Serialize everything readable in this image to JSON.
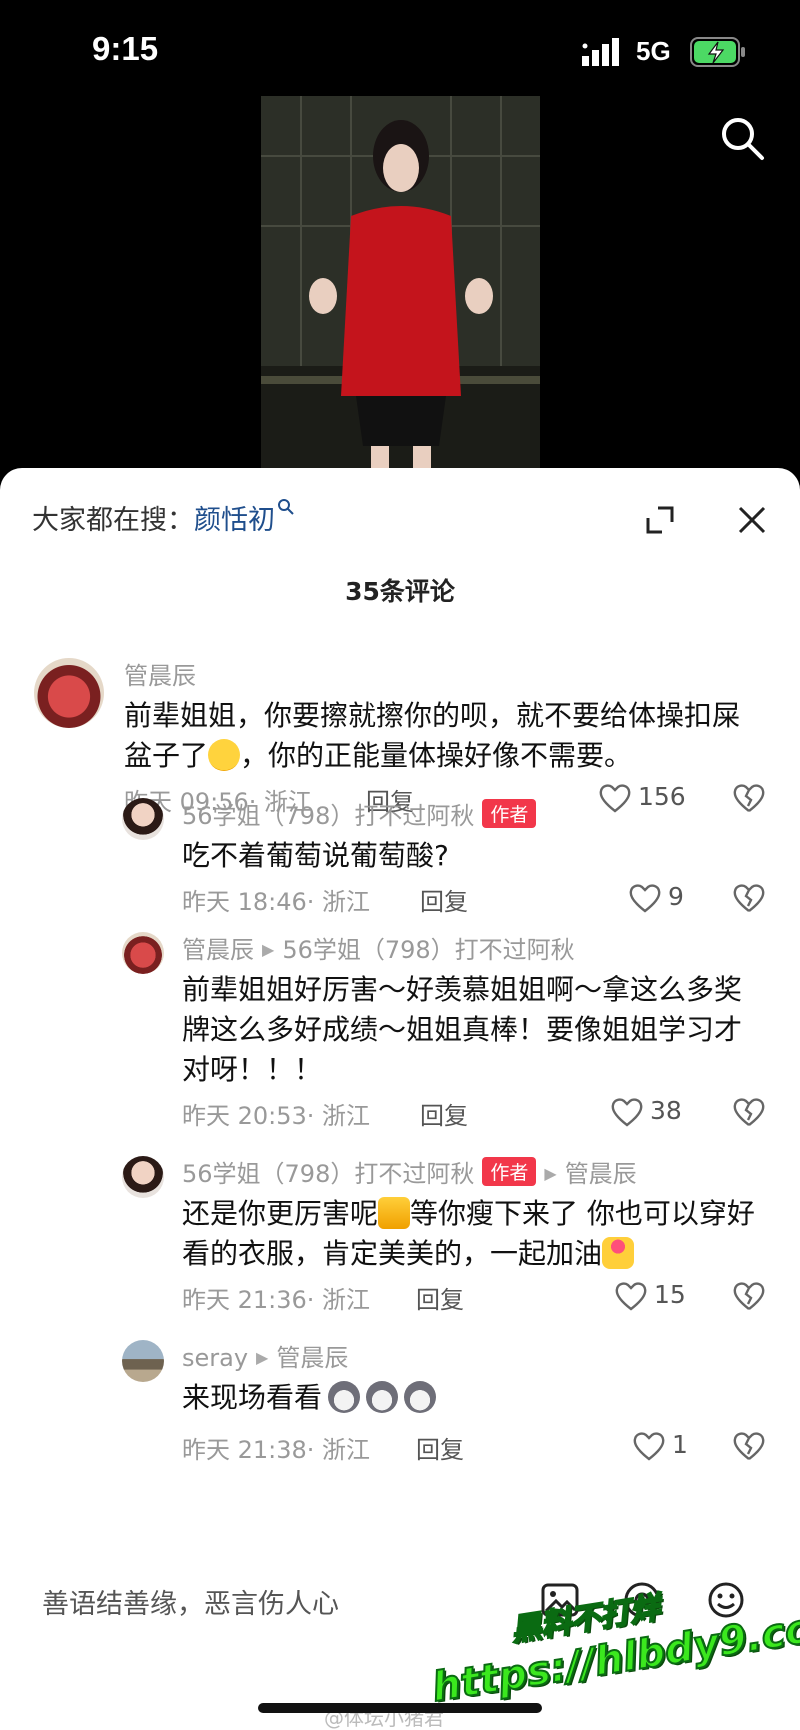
{
  "status": {
    "time": "9:15",
    "network": "5G"
  },
  "trending": {
    "prefix": "大家都在搜：",
    "term": "颜恬初"
  },
  "comments_count": "35条评论",
  "comments": [
    {
      "user": "管晨辰",
      "reply_to": "",
      "is_author": false,
      "text_parts": [
        "前辈姐姐，你要擦就擦你的呗，就不要给体操扣屎盆子了",
        "，你的正能量体操好像不需要。"
      ],
      "time": "昨天 09:56· 浙江",
      "reply": "回复",
      "likes": "156"
    },
    {
      "user": "56学姐（798）打不过阿秋",
      "reply_to": "",
      "is_author": true,
      "text_parts": [
        "吃不着葡萄说葡萄酸?"
      ],
      "time": "昨天 18:46· 浙江",
      "reply": "回复",
      "likes": "9"
    },
    {
      "user": "管晨辰",
      "reply_to": "56学姐（798）打不过阿秋",
      "is_author": false,
      "text_parts": [
        "前辈姐姐好厉害～好羡慕姐姐啊～拿这么多奖牌这么多好成绩～姐姐真棒！要像姐姐学习才对呀！！！"
      ],
      "time": "昨天 20:53· 浙江",
      "reply": "回复",
      "likes": "38"
    },
    {
      "user": "56学姐（798）打不过阿秋",
      "reply_to": "管晨辰",
      "is_author": true,
      "text_parts": [
        "还是你更厉害呢",
        "等你瘦下来了 你也可以穿好看的衣服，肯定美美的，一起加油"
      ],
      "time": "昨天 21:36· 浙江",
      "reply": "回复",
      "likes": "15"
    },
    {
      "user": "seray",
      "reply_to": "管晨辰",
      "is_author": false,
      "text_parts": [
        "来现场看看"
      ],
      "time": "昨天 21:38· 浙江",
      "reply": "回复",
      "likes": "1"
    }
  ],
  "author_tag": "作者",
  "input": {
    "placeholder": "善语结善缘，恶言伤人心"
  },
  "watermark": {
    "line1": "黑料不打烊",
    "line2": "https://hlbdy9.com"
  },
  "credit": "@体坛小猪君",
  "colors": {
    "accent_link": "#1f4e8c",
    "author_tag": "#f2374a",
    "watermark": "#3be81e"
  }
}
